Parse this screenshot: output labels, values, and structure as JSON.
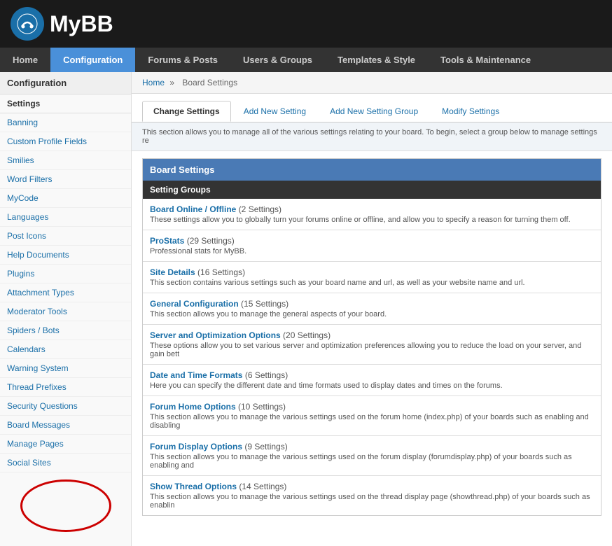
{
  "header": {
    "logo_text": "MyBB"
  },
  "nav": {
    "items": [
      {
        "label": "Home",
        "active": false
      },
      {
        "label": "Configuration",
        "active": true
      },
      {
        "label": "Forums & Posts",
        "active": false
      },
      {
        "label": "Users & Groups",
        "active": false
      },
      {
        "label": "Templates & Style",
        "active": false
      },
      {
        "label": "Tools & Maintenance",
        "active": false
      }
    ]
  },
  "sidebar": {
    "title": "Configuration",
    "subtitle": "Settings",
    "links": [
      "Banning",
      "Custom Profile Fields",
      "Smilies",
      "Word Filters",
      "MyCode",
      "Languages",
      "Post Icons",
      "Help Documents",
      "Plugins",
      "Attachment Types",
      "Moderator Tools",
      "Spiders / Bots",
      "Calendars",
      "Warning System",
      "Thread Prefixes",
      "Security Questions",
      "Board Messages",
      "Manage Pages",
      "Social Sites"
    ]
  },
  "breadcrumb": {
    "home": "Home",
    "separator": "»",
    "current": "Board Settings"
  },
  "tabs": [
    {
      "label": "Change Settings",
      "active": true
    },
    {
      "label": "Add New Setting",
      "active": false
    },
    {
      "label": "Add New Setting Group",
      "active": false
    },
    {
      "label": "Modify Settings",
      "active": false
    }
  ],
  "description": "This section allows you to manage all of the various settings relating to your board. To begin, select a group below to manage settings re",
  "board_settings": {
    "header": "Board Settings",
    "group_header": "Setting Groups",
    "groups": [
      {
        "name": "Board Online / Offline",
        "count": "(2 Settings)",
        "desc": "These settings allow you to globally turn your forums online or offline, and allow you to specify a reason for turning them off."
      },
      {
        "name": "ProStats",
        "count": "(29 Settings)",
        "desc": "Professional stats for MyBB."
      },
      {
        "name": "Site Details",
        "count": "(16 Settings)",
        "desc": "This section contains various settings such as your board name and url, as well as your website name and url."
      },
      {
        "name": "General Configuration",
        "count": "(15 Settings)",
        "desc": "This section allows you to manage the general aspects of your board."
      },
      {
        "name": "Server and Optimization Options",
        "count": "(20 Settings)",
        "desc": "These options allow you to set various server and optimization preferences allowing you to reduce the load on your server, and gain bett"
      },
      {
        "name": "Date and Time Formats",
        "count": "(6 Settings)",
        "desc": "Here you can specify the different date and time formats used to display dates and times on the forums."
      },
      {
        "name": "Forum Home Options",
        "count": "(10 Settings)",
        "desc": "This section allows you to manage the various settings used on the forum home (index.php) of your boards such as enabling and disabling"
      },
      {
        "name": "Forum Display Options",
        "count": "(9 Settings)",
        "desc": "This section allows you to manage the various settings used on the forum display (forumdisplay.php) of your boards such as enabling and"
      },
      {
        "name": "Show Thread Options",
        "count": "(14 Settings)",
        "desc": "This section allows you to manage the various settings used on the thread display page (showthread.php) of your boards such as enablin"
      }
    ]
  }
}
